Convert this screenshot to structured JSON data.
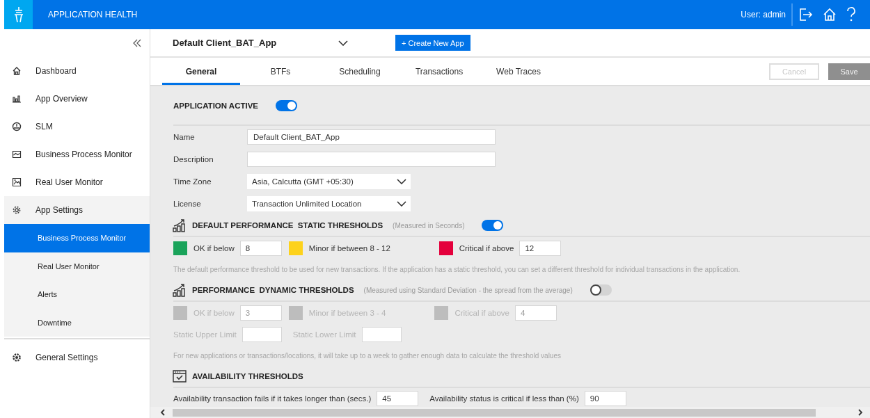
{
  "topbar": {
    "title": "APPLICATION HEALTH",
    "user": "User: admin"
  },
  "sidebar": {
    "items": [
      {
        "label": "Dashboard",
        "selected": false,
        "expanded": false
      },
      {
        "label": "App Overview",
        "selected": false,
        "expanded": false
      },
      {
        "label": "SLM",
        "selected": false,
        "expanded": false
      },
      {
        "label": "Business Process Monitor",
        "selected": false,
        "expanded": false
      },
      {
        "label": "Real User Monitor",
        "selected": false,
        "expanded": false
      },
      {
        "label": "App Settings",
        "selected": false,
        "expanded": true,
        "children": [
          {
            "label": "Business Process Monitor",
            "selected": true
          },
          {
            "label": "Real User Monitor",
            "selected": false
          },
          {
            "label": "Alerts",
            "selected": false
          },
          {
            "label": "Downtime",
            "selected": false
          }
        ]
      },
      {
        "label": "General Settings",
        "selected": false,
        "expanded": false
      }
    ]
  },
  "app_selector": {
    "value": "Default Client_BAT_App"
  },
  "create_button": {
    "label": "+ Create New App"
  },
  "tabs": [
    {
      "label": "General",
      "selected": true
    },
    {
      "label": "BTFs",
      "selected": false
    },
    {
      "label": "Scheduling",
      "selected": false
    },
    {
      "label": "Transactions",
      "selected": false
    },
    {
      "label": "Web Traces",
      "selected": false
    }
  ],
  "buttons": [
    {
      "label": "Cancel",
      "kind": "secondary",
      "disabled": true
    },
    {
      "label": "Save",
      "kind": "primary",
      "disabled": true
    }
  ],
  "application_active": {
    "label": "APPLICATION ACTIVE",
    "on": true
  },
  "fields": [
    {
      "label": "Name",
      "kind": "text",
      "value": "Default Client_BAT_App"
    },
    {
      "label": "Description",
      "kind": "text"
    },
    {
      "label": "Time Zone",
      "kind": "select",
      "value": "Asia, Calcutta (GMT +05:30)"
    },
    {
      "label": "License",
      "kind": "select",
      "value": "Transaction Unlimited Location"
    }
  ],
  "static_thresholds": {
    "title": "DEFAULT PERFORMANCE  STATIC THRESHOLDS",
    "note": "(Measured in Seconds)",
    "on": true,
    "levels": [
      {
        "label": "OK if below",
        "value": "8",
        "color": "#1aa35a"
      },
      {
        "label": "Minor if between 8 - 12",
        "color": "#fdd21c"
      },
      {
        "label": "Critical if above",
        "value": "12",
        "color": "#e4003c"
      }
    ],
    "hint": "The default performance threshold to be used for new transactions. If the application has a static threshold, you can set a different threshold for individual transactions in the application."
  },
  "dynamic_thresholds": {
    "title": "PERFORMANCE  DYNAMIC THRESHOLDS",
    "note": "(Measured using Standard Deviation - the spread from the average)",
    "on": false,
    "levels": [
      {
        "label": "OK if below",
        "value": "3"
      },
      {
        "label": "Minor if between 3 - 4"
      },
      {
        "label": "Critical if above",
        "value": "4"
      }
    ],
    "limits": [
      {
        "label": "Static Upper Limit"
      },
      {
        "label": "Static Lower Limit"
      }
    ],
    "hint": "For new applications or transactions/locations, it will take up to a week to gather enough data to calculate the threshold values"
  },
  "availability": {
    "title": "AVAILABILITY THRESHOLDS",
    "fields": [
      {
        "label": "Availability transaction fails if it takes longer than (secs.)",
        "value": "45"
      },
      {
        "label": "Availability status is critical if less than (%)",
        "value": "90"
      }
    ]
  }
}
